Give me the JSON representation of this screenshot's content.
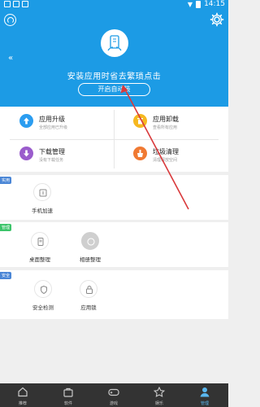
{
  "status_bar": {
    "time": "14:15"
  },
  "hero": {
    "title": "安装应用时省去繁琐点击",
    "button_label": "开启自动装"
  },
  "features": [
    {
      "title": "应用升级",
      "subtitle": "全部应用已升级",
      "icon": "upload-icon",
      "color": "#2b9df0"
    },
    {
      "title": "应用卸载",
      "subtitle": "查看所有应用",
      "icon": "trash-icon",
      "color": "#f6b820"
    },
    {
      "title": "下载管理",
      "subtitle": "没有下载任务",
      "icon": "download-icon",
      "color": "#9a5ccc"
    },
    {
      "title": "垃圾清理",
      "subtitle": "清理释放空间",
      "icon": "broom-icon",
      "color": "#f07a33"
    }
  ],
  "sections": [
    {
      "tag": "实用",
      "tag_color": "#4a86d6",
      "tools": [
        {
          "label": "手机加速",
          "icon": "speedup-icon"
        }
      ]
    },
    {
      "tag": "管理",
      "tag_color": "#3cc46a",
      "tools": [
        {
          "label": "桌面整理",
          "icon": "desktop-icon"
        },
        {
          "label": "相册整理",
          "icon": "album-icon"
        }
      ]
    },
    {
      "tag": "安全",
      "tag_color": "#4a86d6",
      "tools": [
        {
          "label": "安全检测",
          "icon": "shield-icon"
        },
        {
          "label": "应用锁",
          "icon": "lock-icon"
        }
      ]
    }
  ],
  "tabs": [
    {
      "label": "推荐",
      "icon": "home-icon"
    },
    {
      "label": "软件",
      "icon": "bag-icon"
    },
    {
      "label": "游戏",
      "icon": "gamepad-icon"
    },
    {
      "label": "娱乐",
      "icon": "star-icon"
    },
    {
      "label": "管理",
      "icon": "person-icon",
      "active": true
    }
  ],
  "colors": {
    "header": "#1c9be5",
    "tabbar": "#333333",
    "active_tab": "#5ab8f0",
    "annotation_arrow": "#d9393b"
  }
}
